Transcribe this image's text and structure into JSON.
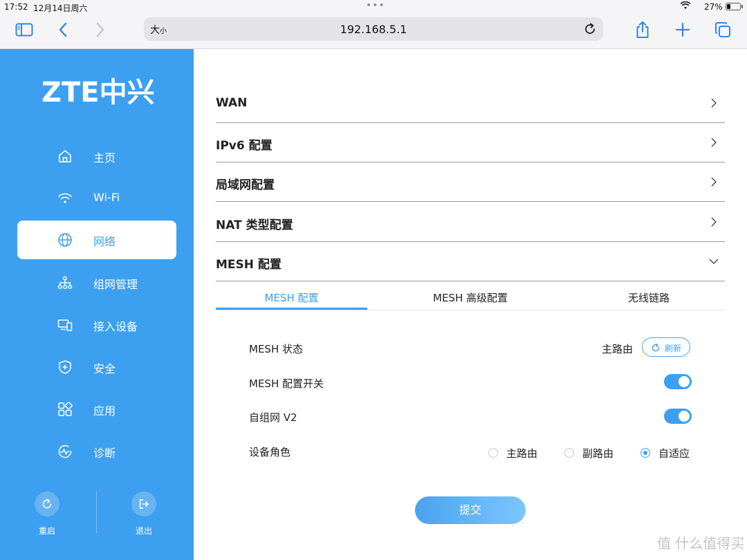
{
  "status_bar": {
    "time": "17:52",
    "date": "12月14日周六",
    "dots": "•••",
    "battery": "27%",
    "battery_level": 0.27
  },
  "browser": {
    "text_size_label": "大",
    "text_size_small": "小",
    "url": "192.168.5.1"
  },
  "sidebar": {
    "brand": "ZTE中兴",
    "items": [
      {
        "label": "主页",
        "icon": "home-icon"
      },
      {
        "label": "Wi-Fi",
        "icon": "wifi-icon"
      },
      {
        "label": "网络",
        "icon": "globe-icon",
        "active": true
      },
      {
        "label": "组网管理",
        "icon": "network-topology-icon"
      },
      {
        "label": "接入设备",
        "icon": "devices-icon"
      },
      {
        "label": "安全",
        "icon": "shield-icon"
      },
      {
        "label": "应用",
        "icon": "apps-icon"
      },
      {
        "label": "诊断",
        "icon": "diagnose-icon"
      }
    ],
    "restart_label": "重启",
    "logout_label": "退出"
  },
  "sections": [
    {
      "title": "WAN",
      "expanded": false
    },
    {
      "title": "IPv6 配置",
      "expanded": false
    },
    {
      "title": "局域网配置",
      "expanded": false
    },
    {
      "title": "NAT 类型配置",
      "expanded": false
    },
    {
      "title": "MESH 配置",
      "expanded": true
    }
  ],
  "tabs": [
    {
      "label": "MESH 配置",
      "active": true
    },
    {
      "label": "MESH 高级配置",
      "active": false
    },
    {
      "label": "无线链路",
      "active": false
    }
  ],
  "form": {
    "mesh_status_label": "MESH 状态",
    "mesh_status_value": "主路由",
    "refresh_label": "刷新",
    "mesh_switch_label": "MESH 配置开关",
    "mesh_switch_on": true,
    "self_network_label": "自组网 V2",
    "self_network_on": true,
    "role_label": "设备角色",
    "role_options": [
      {
        "label": "主路由",
        "checked": false
      },
      {
        "label": "副路由",
        "checked": false
      },
      {
        "label": "自适应",
        "checked": true
      }
    ],
    "submit_label": "提交"
  },
  "watermark": "值 什么值得买",
  "colors": {
    "accent": "#3d9fef",
    "sidebar_bg": "#3d9fef"
  }
}
